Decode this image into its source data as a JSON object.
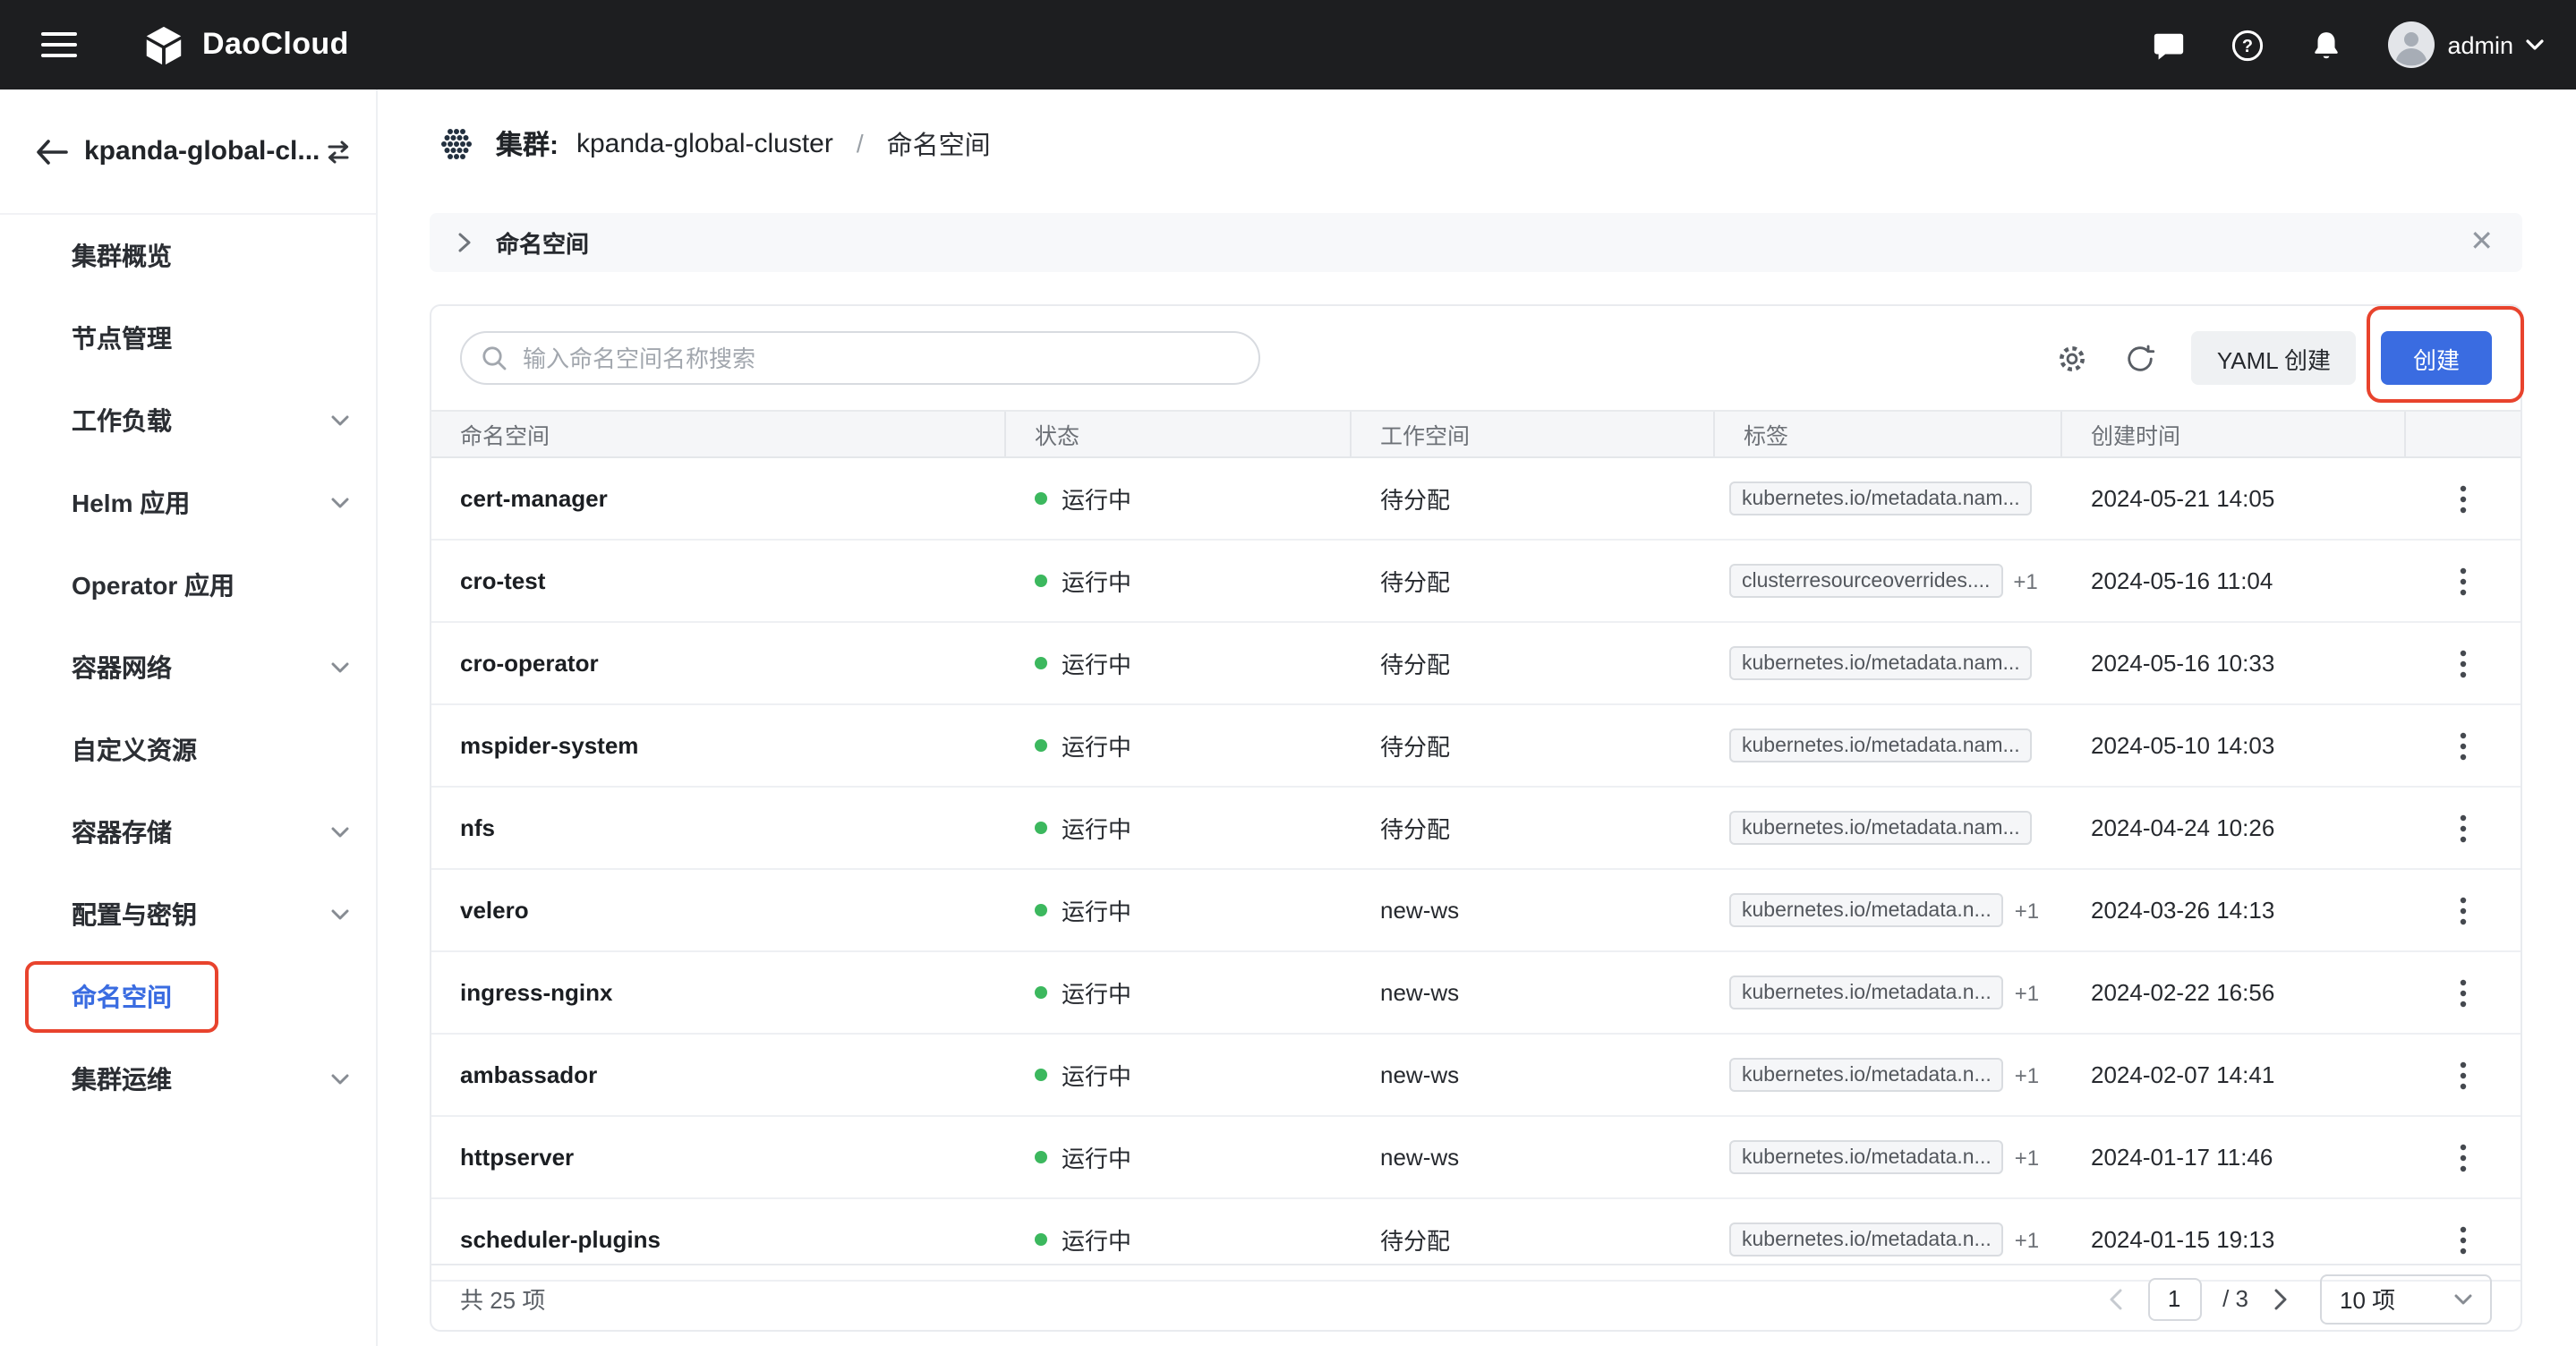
{
  "colors": {
    "accent": "#3a6ce1",
    "annotation": "#e8432d",
    "status_green": "#3cb85e",
    "topbar_bg": "#1d1e20"
  },
  "topbar": {
    "brand": "DaoCloud",
    "user": "admin"
  },
  "sidebar": {
    "cluster_name": "kpanda-global-cl...",
    "items": [
      {
        "label": "集群概览",
        "expandable": false,
        "active": false
      },
      {
        "label": "节点管理",
        "expandable": false,
        "active": false
      },
      {
        "label": "工作负载",
        "expandable": true,
        "active": false
      },
      {
        "label": "Helm 应用",
        "expandable": true,
        "active": false
      },
      {
        "label": "Operator 应用",
        "expandable": false,
        "active": false
      },
      {
        "label": "容器网络",
        "expandable": true,
        "active": false
      },
      {
        "label": "自定义资源",
        "expandable": false,
        "active": false
      },
      {
        "label": "容器存储",
        "expandable": true,
        "active": false
      },
      {
        "label": "配置与密钥",
        "expandable": true,
        "active": false
      },
      {
        "label": "命名空间",
        "expandable": false,
        "active": true
      },
      {
        "label": "集群运维",
        "expandable": true,
        "active": false
      }
    ]
  },
  "breadcrumb": {
    "prefix": "集群:",
    "cluster": "kpanda-global-cluster",
    "separator": "/",
    "current": "命名空间"
  },
  "panel": {
    "title": "命名空间"
  },
  "toolbar": {
    "search_placeholder": "输入命名空间名称搜索",
    "yaml_create": "YAML 创建",
    "create": "创建"
  },
  "table": {
    "columns": [
      "命名空间",
      "状态",
      "工作空间",
      "标签",
      "创建时间"
    ],
    "rows": [
      {
        "name": "cert-manager",
        "status": "运行中",
        "workspace": "待分配",
        "tag": "kubernetes.io/metadata.nam...",
        "extra": "",
        "created": "2024-05-21 14:05"
      },
      {
        "name": "cro-test",
        "status": "运行中",
        "workspace": "待分配",
        "tag": "clusterresourceoverrides....",
        "extra": "+1",
        "created": "2024-05-16 11:04"
      },
      {
        "name": "cro-operator",
        "status": "运行中",
        "workspace": "待分配",
        "tag": "kubernetes.io/metadata.nam...",
        "extra": "",
        "created": "2024-05-16 10:33"
      },
      {
        "name": "mspider-system",
        "status": "运行中",
        "workspace": "待分配",
        "tag": "kubernetes.io/metadata.nam...",
        "extra": "",
        "created": "2024-05-10 14:03"
      },
      {
        "name": "nfs",
        "status": "运行中",
        "workspace": "待分配",
        "tag": "kubernetes.io/metadata.nam...",
        "extra": "",
        "created": "2024-04-24 10:26"
      },
      {
        "name": "velero",
        "status": "运行中",
        "workspace": "new-ws",
        "tag": "kubernetes.io/metadata.n...",
        "extra": "+1",
        "created": "2024-03-26 14:13"
      },
      {
        "name": "ingress-nginx",
        "status": "运行中",
        "workspace": "new-ws",
        "tag": "kubernetes.io/metadata.n...",
        "extra": "+1",
        "created": "2024-02-22 16:56"
      },
      {
        "name": "ambassador",
        "status": "运行中",
        "workspace": "new-ws",
        "tag": "kubernetes.io/metadata.n...",
        "extra": "+1",
        "created": "2024-02-07 14:41"
      },
      {
        "name": "httpserver",
        "status": "运行中",
        "workspace": "new-ws",
        "tag": "kubernetes.io/metadata.n...",
        "extra": "+1",
        "created": "2024-01-17 11:46"
      },
      {
        "name": "scheduler-plugins",
        "status": "运行中",
        "workspace": "待分配",
        "tag": "kubernetes.io/metadata.n...",
        "extra": "+1",
        "created": "2024-01-15 19:13"
      }
    ]
  },
  "pagination": {
    "total": "共 25 项",
    "page": "1",
    "of": "/ 3",
    "page_size": "10 项"
  }
}
